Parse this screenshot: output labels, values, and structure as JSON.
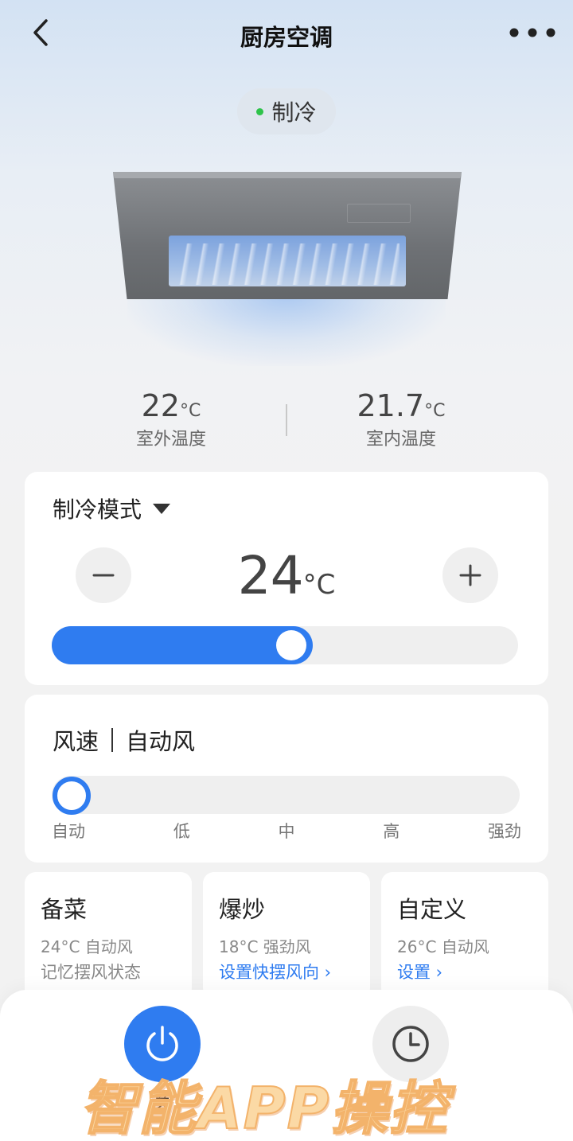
{
  "header": {
    "title": "厨房空调"
  },
  "status": {
    "text": "制冷",
    "dot_color": "#2ec34a"
  },
  "temperatures": {
    "outdoor_value": "22",
    "outdoor_unit": "°C",
    "outdoor_label": "室外温度",
    "indoor_value": "21.7",
    "indoor_unit": "°C",
    "indoor_label": "室内温度"
  },
  "mode_card": {
    "mode_label": "制冷模式",
    "set_temp": "24",
    "set_temp_unit": "°C",
    "slider_fraction": 0.56
  },
  "fan_card": {
    "label": "风速",
    "value": "自动风",
    "levels": [
      "自动",
      "低",
      "中",
      "高",
      "强劲"
    ],
    "selected_index": 0
  },
  "presets": [
    {
      "name": "备菜",
      "desc": "24°C 自动风",
      "sub": "记忆摆风状态"
    },
    {
      "name": "爆炒",
      "desc": "18°C 强劲风",
      "link": "设置快摆风向 ›"
    },
    {
      "name": "自定义",
      "desc": "26°C 自动风",
      "link": "设置 ›"
    }
  ],
  "bottom": {
    "power_label": "关",
    "timer_label": ""
  },
  "watermark": {
    "text": "智能APP操控"
  },
  "colors": {
    "accent": "#2f7cf0",
    "status_green": "#2ec34a",
    "watermark": "#fbd9a5"
  },
  "icons": {
    "back": "chevron-left-icon",
    "more": "more-dots-icon",
    "dropdown": "caret-down-icon",
    "minus": "minus-icon",
    "plus": "plus-icon",
    "power": "power-icon",
    "timer": "clock-icon"
  }
}
